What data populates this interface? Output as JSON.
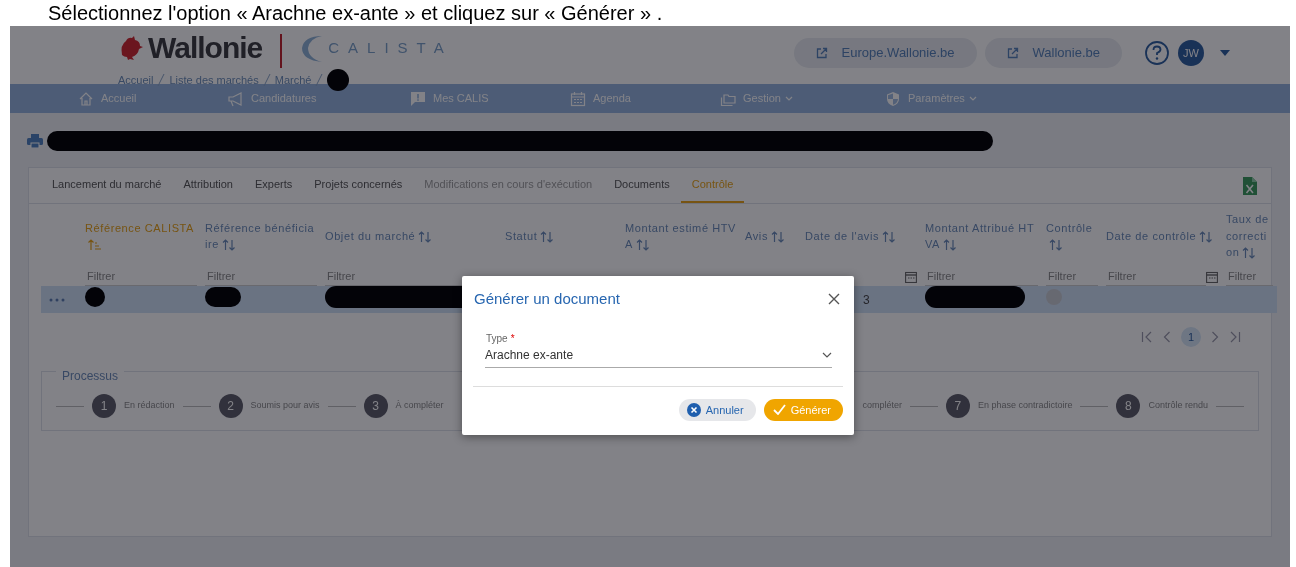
{
  "caption": "Sélectionnez l'option « Arachne ex-ante » et cliquez sur « Générer » .",
  "header": {
    "logo": "Wallonie",
    "app": "CALISTA",
    "breadcrumb": [
      {
        "kind": "link",
        "label": "Accueil"
      },
      {
        "kind": "link",
        "label": "Liste des marchés"
      },
      {
        "kind": "link",
        "label": "Marché"
      },
      {
        "kind": "redacted"
      }
    ],
    "links": [
      {
        "label": "Europe.Wallonie.be"
      },
      {
        "label": "Wallonie.be"
      }
    ],
    "avatar": "JW"
  },
  "nav": [
    {
      "label": "Accueil",
      "dropdown": false
    },
    {
      "label": "Candidatures",
      "dropdown": false
    },
    {
      "label": "Mes CALIS",
      "dropdown": false
    },
    {
      "label": "Agenda",
      "dropdown": false
    },
    {
      "label": "Gestion",
      "dropdown": true
    },
    {
      "label": "Paramètres",
      "dropdown": true
    }
  ],
  "page_title": {
    "redacted": true
  },
  "tabs": [
    {
      "label": "Lancement du marché",
      "selected": false,
      "disabled": false
    },
    {
      "label": "Attribution",
      "selected": false,
      "disabled": false
    },
    {
      "label": "Experts",
      "selected": false,
      "disabled": false
    },
    {
      "label": "Projets concernés",
      "selected": false,
      "disabled": false
    },
    {
      "label": "Modifications en cours d'exécution",
      "selected": false,
      "disabled": true
    },
    {
      "label": "Documents",
      "selected": false,
      "disabled": false
    },
    {
      "label": "Contrôle",
      "selected": true,
      "disabled": false
    }
  ],
  "table": {
    "columns": [
      {
        "label": "Référence CALISTA",
        "sorted": true,
        "filter": {
          "kind": "text",
          "placeholder": "Filtrer"
        }
      },
      {
        "label": "Référence bénéficiaire",
        "sorted": false,
        "filter": {
          "kind": "text",
          "placeholder": "Filtrer"
        }
      },
      {
        "label": "Objet du marché",
        "sorted": false,
        "filter": {
          "kind": "text",
          "placeholder": "Filtrer"
        }
      },
      {
        "label": "Statut",
        "sorted": false
      },
      {
        "label": "Montant estimé HTVA",
        "sorted": false
      },
      {
        "label": "Avis",
        "sorted": false
      },
      {
        "label": "Date de l'avis",
        "sorted": false,
        "filter": {
          "kind": "date"
        }
      },
      {
        "label": "Montant Attribué HTVA",
        "sorted": false,
        "filter": {
          "kind": "text",
          "placeholder": "Filtrer"
        }
      },
      {
        "label": "Contrôle",
        "sorted": false,
        "filter": {
          "kind": "text",
          "placeholder": "Filtrer"
        }
      },
      {
        "label": "Date de contrôle",
        "sorted": false,
        "filter": {
          "kind": "date",
          "placeholder": "Filtrer"
        }
      },
      {
        "label": "Taux de correction",
        "sorted": false,
        "filter": {
          "kind": "text",
          "placeholder": "Filtrer"
        }
      }
    ],
    "rows": [
      {
        "selected": true,
        "cells": [
          {
            "kind": "redacted"
          },
          {
            "kind": "redacted"
          },
          {
            "kind": "redacted"
          },
          {
            "kind": "empty"
          },
          {
            "kind": "empty"
          },
          {
            "kind": "empty"
          },
          {
            "kind": "text",
            "text": "3"
          },
          {
            "kind": "redacted"
          },
          {
            "kind": "status_dot"
          },
          {
            "kind": "empty"
          },
          {
            "kind": "empty"
          }
        ]
      }
    ],
    "pagination": {
      "pages": [
        {
          "label": "1",
          "selected": true
        }
      ]
    }
  },
  "process": {
    "title": "Processus",
    "steps_left": [
      {
        "number": "1",
        "label": "En rédaction"
      },
      {
        "number": "2",
        "label": "Soumis pour avis"
      },
      {
        "number": "3",
        "label": "À compléter"
      }
    ],
    "steps_right": [
      {
        "label": "compléter"
      },
      {
        "number": "7",
        "label": "En phase contradictoire"
      },
      {
        "number": "8",
        "label": "Contrôle rendu"
      }
    ]
  },
  "modal": {
    "title": "Générer un document",
    "field": {
      "label": "Type",
      "required_mark": "*",
      "value": "Arachne ex-ante"
    },
    "buttons": [
      {
        "label": "Annuler",
        "kind": "cancel"
      },
      {
        "label": "Générer",
        "kind": "primary"
      }
    ]
  }
}
